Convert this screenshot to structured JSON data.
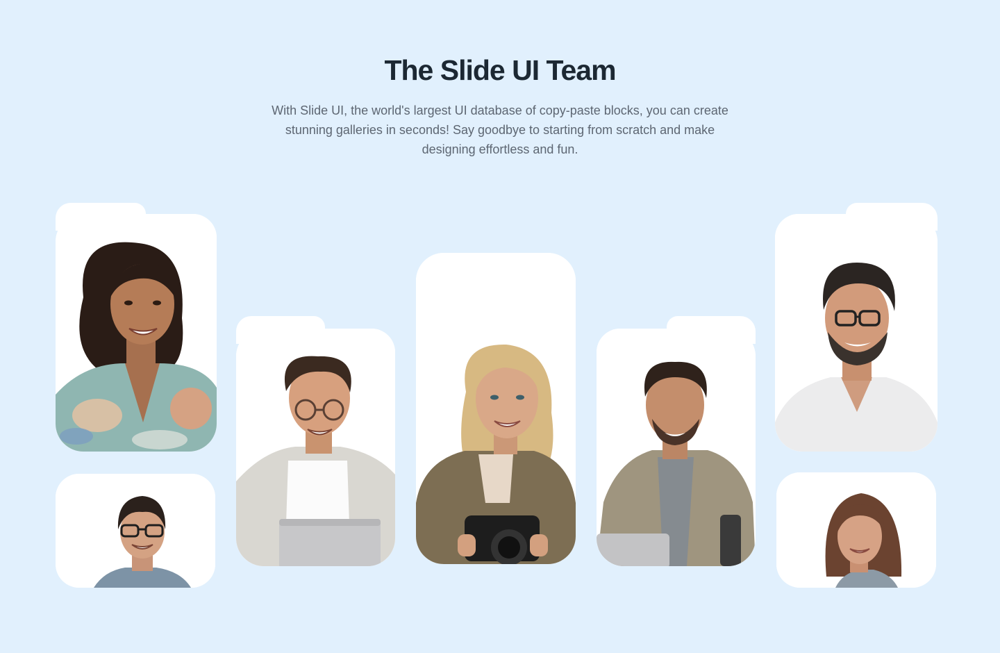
{
  "header": {
    "title": "The Slide UI Team",
    "description": "With Slide UI, the world's largest UI database of copy-paste blocks, you can create stunning galleries in seconds! Say goodbye to starting from scratch and make designing effortless and fun."
  },
  "colors": {
    "background": "#e1f0fd",
    "card": "#ffffff",
    "title": "#1c2833",
    "text": "#5d6672"
  },
  "team_members": [
    {
      "photo": "woman-curly-hair-floral-shirt-portrait"
    },
    {
      "photo": "man-glasses-small-portrait"
    },
    {
      "photo": "man-round-glasses-laptop-portrait"
    },
    {
      "photo": "woman-blonde-camera-portrait"
    },
    {
      "photo": "man-jacket-laptop-portrait"
    },
    {
      "photo": "man-glasses-beard-white-shirt-portrait"
    },
    {
      "photo": "woman-brown-hair-small-portrait"
    }
  ]
}
